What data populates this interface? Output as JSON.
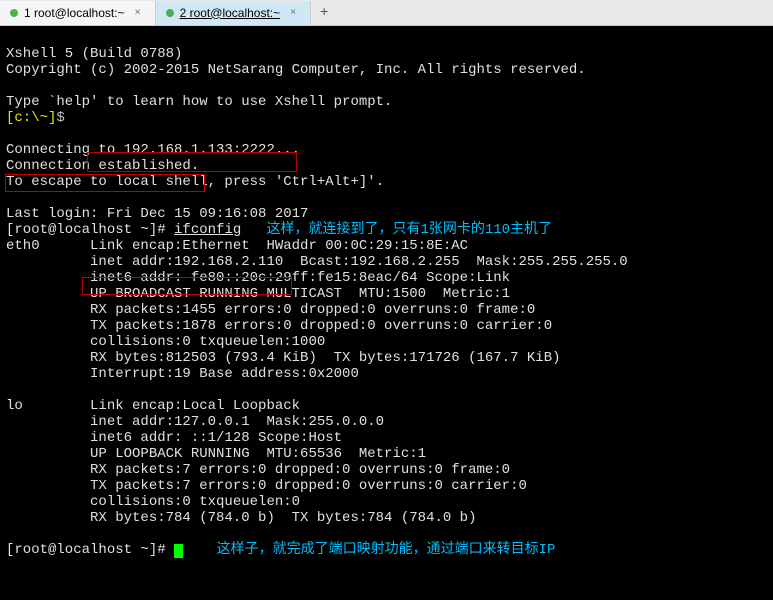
{
  "tabs": {
    "items": [
      {
        "label": "1 root@localhost:~"
      },
      {
        "label": "2 root@localhost:~"
      }
    ],
    "add": "+"
  },
  "header": {
    "title": "Xshell 5 (Build 0788)",
    "copyright": "Copyright (c) 2002-2015 NetSarang Computer, Inc. All rights reserved.",
    "help_line": "Type `help' to learn how to use Xshell prompt.",
    "prompt_prefix": "[c:\\~]",
    "prompt_dollar": "$"
  },
  "connection": {
    "connecting": "Connecting to 192.168.1.133:2222...",
    "established": "Connection established.",
    "escape": "To escape to local shell, press 'Ctrl+Alt+]'."
  },
  "session": {
    "last_login": "Last login: Fri Dec 15 09:16:08 2017",
    "prompt": "[root@localhost ~]# ",
    "command": "ifconfig",
    "annotation1": "   这样，就连接到了，只有1张网卡的110主机了"
  },
  "eth0": {
    "line1": "eth0      Link encap:Ethernet  HWaddr 00:0C:29:15:8E:AC",
    "line2": "          inet addr:192.168.2.110  Bcast:192.168.2.255  Mask:255.255.255.0",
    "line3": "          inet6 addr: fe80::20c:29ff:fe15:8eac/64 Scope:Link",
    "line4": "          UP BROADCAST RUNNING MULTICAST  MTU:1500  Metric:1",
    "line5": "          RX packets:1455 errors:0 dropped:0 overruns:0 frame:0",
    "line6": "          TX packets:1878 errors:0 dropped:0 overruns:0 carrier:0",
    "line7": "          collisions:0 txqueuelen:1000",
    "line8": "          RX bytes:812503 (793.4 KiB)  TX bytes:171726 (167.7 KiB)",
    "line9": "          Interrupt:19 Base address:0x2000"
  },
  "lo": {
    "line1": "lo        Link encap:Local Loopback",
    "line2": "          inet addr:127.0.0.1  Mask:255.0.0.0",
    "line3": "          inet6 addr: ::1/128 Scope:Host",
    "line4": "          UP LOOPBACK RUNNING  MTU:65536  Metric:1",
    "line5": "          RX packets:7 errors:0 dropped:0 overruns:0 frame:0",
    "line6": "          TX packets:7 errors:0 dropped:0 overruns:0 carrier:0",
    "line7": "          collisions:0 txqueuelen:0",
    "line8": "          RX bytes:784 (784.0 b)  TX bytes:784 (784.0 b)"
  },
  "footer": {
    "prompt": "[root@localhost ~]# ",
    "annotation2": "    这样子，就完成了端口映射功能，通过端口来转目标IP"
  }
}
